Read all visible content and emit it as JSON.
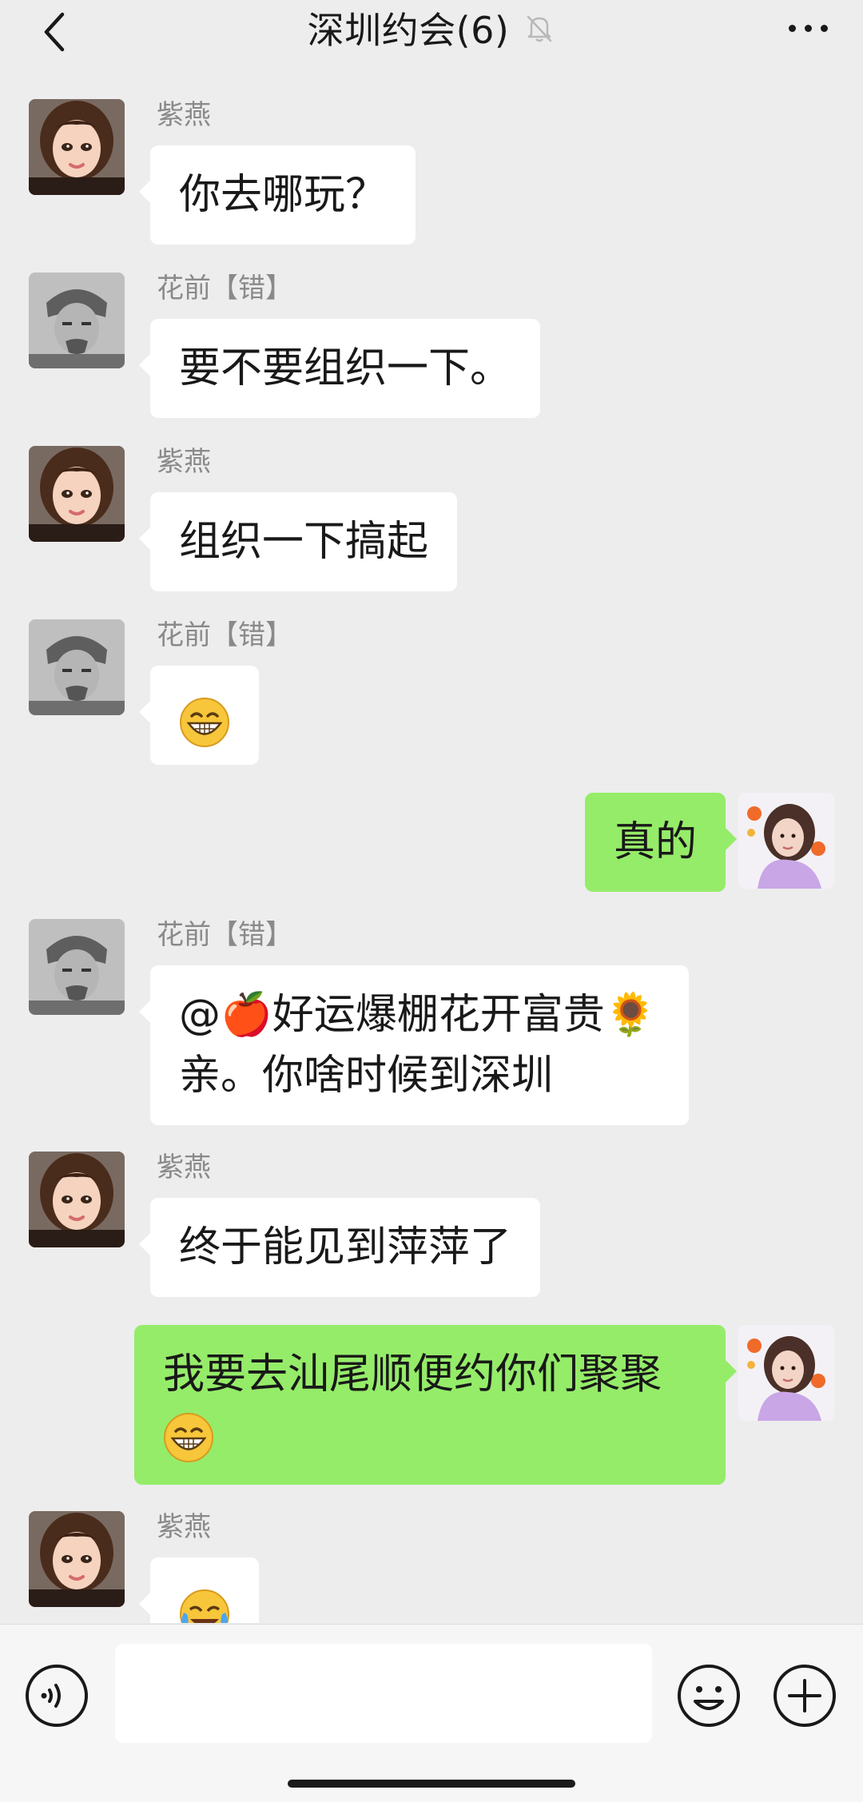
{
  "header": {
    "title": "深圳约会(6)",
    "muted_icon": "bell-slash-icon",
    "back_icon": "chevron-left-icon",
    "more_icon": "ellipsis-icon"
  },
  "messages": [
    {
      "sender": "紫燕",
      "text": "你去哪玩？",
      "direction": "in"
    },
    {
      "sender": "花前【错】",
      "text": "要不要组织一下。",
      "direction": "in"
    },
    {
      "sender": "紫燕",
      "text": "组织一下搞起",
      "direction": "in"
    },
    {
      "sender": "花前【错】",
      "text": "",
      "emoji": "grinning-face-icon",
      "direction": "in"
    },
    {
      "sender": "",
      "text": "真的",
      "direction": "out"
    },
    {
      "sender": "花前【错】",
      "line1": "@🍎好运爆棚花开富贵🌻",
      "line2": "亲。你啥时候到深圳",
      "direction": "in"
    },
    {
      "sender": "紫燕",
      "text": "终于能见到萍萍了",
      "direction": "in"
    },
    {
      "sender": "",
      "text": "我要去汕尾顺便约你们聚聚",
      "emoji": "grinning-face-icon",
      "direction": "out"
    },
    {
      "sender": "紫燕",
      "text": "",
      "emoji": "crying-laughing-face-icon",
      "direction": "in"
    }
  ],
  "input": {
    "value": "",
    "voice_icon": "voice-icon",
    "emoji_icon": "smiley-icon",
    "plus_icon": "plus-circle-icon"
  },
  "colors": {
    "background": "#ededed",
    "bubble_in": "#ffffff",
    "bubble_out": "#95ec69",
    "sender_name": "#8a8a8a"
  }
}
